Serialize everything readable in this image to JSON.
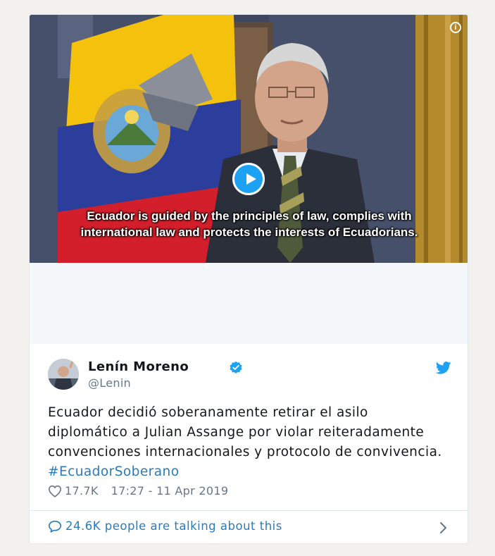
{
  "video": {
    "caption_line1": "Ecuador is guided by the principles of law, complies with",
    "caption_line2": "international law and protects the interests of Ecuadorians.",
    "info_glyph": "i"
  },
  "tweet": {
    "author_name": "Lenín Moreno",
    "author_handle": "@Lenin",
    "text": "Ecuador decidió soberanamente retirar el asilo diplomático a Julian Assange por violar reiteradamente convenciones internacionales y protocolo de convivencia. ",
    "hashtag": "#EcuadorSoberano",
    "likes": "17.7K",
    "timestamp": "17:27 - 11 Apr 2019"
  },
  "footer": {
    "talking_text": "24.6K people are talking about this"
  },
  "colors": {
    "twitter_blue": "#1da1f2",
    "link_blue": "#2b7bb9",
    "muted_gray": "#657786",
    "text_dark": "#14171a"
  },
  "icons": [
    "play-icon",
    "info-icon",
    "verified-badge-icon",
    "twitter-bird-icon",
    "heart-icon",
    "chat-bubble-icon",
    "chevron-right-icon"
  ]
}
